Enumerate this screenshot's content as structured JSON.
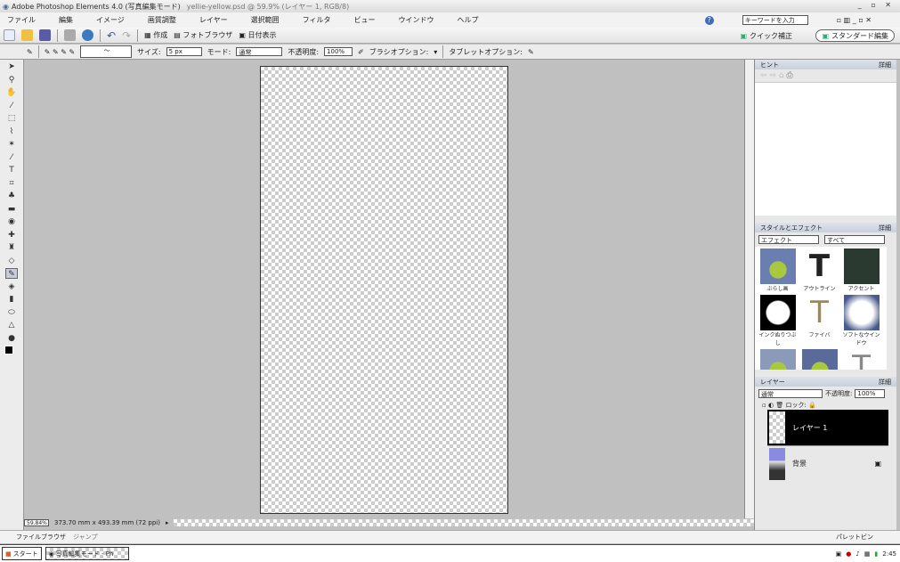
{
  "window": {
    "title": "Adobe Photoshop Elements 4.0 (写真編集モード)",
    "doc_title": "yellie-yellow.psd @ 59.9% (レイヤー 1, RGB/8)",
    "controls": "_ ▫ ✕"
  },
  "menu": [
    "ファイル",
    "編集",
    "イメージ",
    "画質調整",
    "レイヤー",
    "選択範囲",
    "フィルタ",
    "ビュー",
    "ウインドウ",
    "ヘルプ"
  ],
  "help_search": {
    "placeholder": "キーワードを入力"
  },
  "toolbar": {
    "create": "作成",
    "organizer": "フォトブラウザ",
    "date_view": "日付表示",
    "quick_fix": "クイック補正",
    "standard_edit": "スタンダード編集"
  },
  "options": {
    "size_label": "サイズ:",
    "size_value": "5 px",
    "mode_label": "モード:",
    "mode_value": "通常",
    "opacity_label": "不透明度:",
    "opacity_value": "100%",
    "brush_options": "ブラシオプション:",
    "tablet_options": "タブレットオプション:"
  },
  "status": {
    "zoom": "59.84%",
    "dimensions": "373.70 mm x 493.39 mm (72 ppi)"
  },
  "hint_panel": {
    "title": "ヒント",
    "more": "詳細"
  },
  "styles_panel": {
    "title": "スタイルとエフェクト",
    "more": "詳細",
    "category": "エフェクト",
    "filter": "すべて",
    "items": [
      "ぶらし画",
      "アウトライン",
      "アクセント",
      "インクぬりつぶし",
      "ファイバ",
      "ソフトなウインドウ",
      "",
      "",
      ""
    ]
  },
  "layers_panel": {
    "title": "レイヤー",
    "more": "詳細",
    "blend_mode": "通常",
    "opacity_label": "不透明度:",
    "opacity_value": "100%",
    "lock_label": "ロック:",
    "layers": [
      {
        "name": "レイヤー 1",
        "selected": true
      },
      {
        "name": "背景",
        "selected": false
      }
    ]
  },
  "bottom_bar": {
    "left": "ファイルブラウザ",
    "hint": "ジャンプ",
    "right": "パレットビン"
  },
  "taskbar": {
    "start": "スタート",
    "task": "写真編集モード - Ph",
    "clock": "2:45"
  }
}
